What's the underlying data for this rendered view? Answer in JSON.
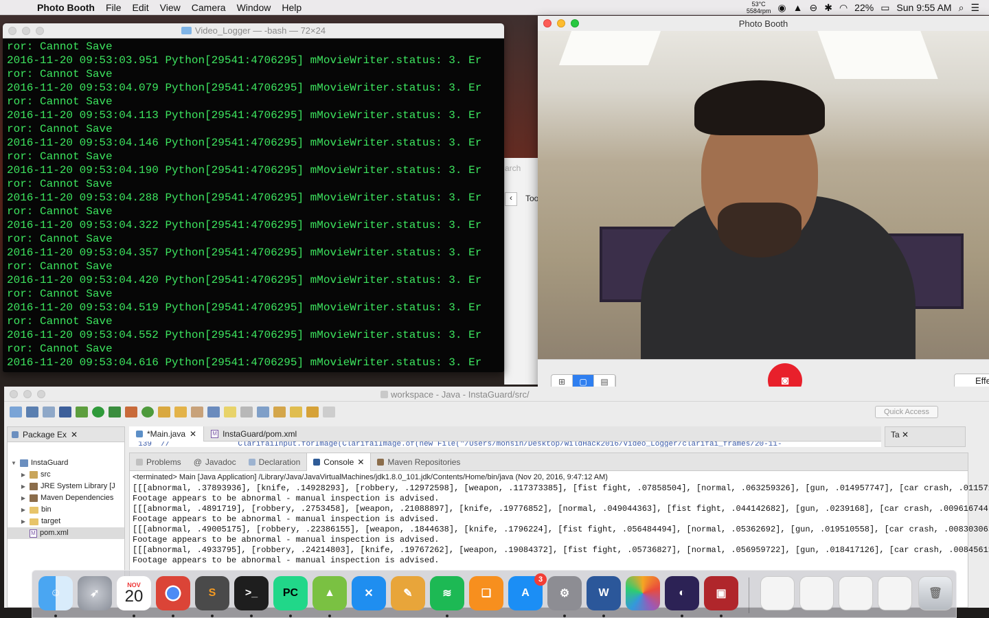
{
  "menubar": {
    "app_name": "Photo Booth",
    "menus": [
      "File",
      "Edit",
      "View",
      "Camera",
      "Window",
      "Help"
    ],
    "temp": "53°C",
    "rpm": "5584rpm",
    "battery": "22%",
    "clock": "Sun 9:55 AM"
  },
  "terminal": {
    "title": "Video_Logger — -bash — 72×24",
    "lines": [
      "ror: Cannot Save",
      "2016-11-20 09:53:03.951 Python[29541:4706295] mMovieWriter.status: 3. Er",
      "ror: Cannot Save",
      "2016-11-20 09:53:04.079 Python[29541:4706295] mMovieWriter.status: 3. Er",
      "ror: Cannot Save",
      "2016-11-20 09:53:04.113 Python[29541:4706295] mMovieWriter.status: 3. Er",
      "ror: Cannot Save",
      "2016-11-20 09:53:04.146 Python[29541:4706295] mMovieWriter.status: 3. Er",
      "ror: Cannot Save",
      "2016-11-20 09:53:04.190 Python[29541:4706295] mMovieWriter.status: 3. Er",
      "ror: Cannot Save",
      "2016-11-20 09:53:04.288 Python[29541:4706295] mMovieWriter.status: 3. Er",
      "ror: Cannot Save",
      "2016-11-20 09:53:04.322 Python[29541:4706295] mMovieWriter.status: 3. Er",
      "ror: Cannot Save",
      "2016-11-20 09:53:04.357 Python[29541:4706295] mMovieWriter.status: 3. Er",
      "ror: Cannot Save",
      "2016-11-20 09:53:04.420 Python[29541:4706295] mMovieWriter.status: 3. Er",
      "ror: Cannot Save",
      "2016-11-20 09:53:04.519 Python[29541:4706295] mMovieWriter.status: 3. Er",
      "ror: Cannot Save",
      "2016-11-20 09:53:04.552 Python[29541:4706295] mMovieWriter.status: 3. Er",
      "ror: Cannot Save",
      "2016-11-20 09:53:04.616 Python[29541:4706295] mMovieWriter.status: 3. Er"
    ]
  },
  "bg_window": {
    "search": "arch",
    "tool": "Too"
  },
  "photobooth": {
    "title": "Photo Booth",
    "effects_label": "Effe"
  },
  "eclipse": {
    "title": "workspace - Java - InstaGuard/src/",
    "quick_access": "Quick Access",
    "package_explorer": {
      "tab": "Package Ex",
      "items": [
        {
          "label": "InstaGuard",
          "icon": "project-icon"
        },
        {
          "label": "src",
          "icon": "package-icon"
        },
        {
          "label": "JRE System Library [J",
          "icon": "library-icon"
        },
        {
          "label": "Maven Dependencies",
          "icon": "library-icon"
        },
        {
          "label": "bin",
          "icon": "folder-icon"
        },
        {
          "label": "target",
          "icon": "folder-icon"
        },
        {
          "label": "pom.xml",
          "icon": "xml-file-icon"
        }
      ]
    },
    "editor_tabs": [
      "*Main.java",
      "InstaGuard/pom.xml"
    ],
    "editor_snippet": "  139  //               ClarifaiInput.forImage(ClarifaiImage.of(new File(\"/Users/mohsin/Desktop/WildHack2016/Video_Logger/clarifai_frames/20-11-",
    "outline_tab": "Ta",
    "console": {
      "tabs": [
        "Problems",
        "Javadoc",
        "Declaration",
        "Console",
        "Maven Repositories"
      ],
      "terminated": "<terminated> Main [Java Application] /Library/Java/JavaVirtualMachines/jdk1.8.0_101.jdk/Contents/Home/bin/java (Nov 20, 2016, 9:47:12 AM)",
      "lines": [
        "[[[abnormal, .37893936], [knife, .14928293], [robbery, .12972598], [weapon, .117373385], [fist fight, .07858504], [normal, .063259326], [gun, .014957747], [car crash, .011571",
        "Footage appears to be abnormal - manual inspection is advised.",
        "[[[abnormal, .4891719], [robbery, .2753458], [weapon, .21088897], [knife, .19776852], [normal, .049044363], [fist fight, .044142682], [gun, .0239168], [car crash, .009616744]",
        "Footage appears to be abnormal - manual inspection is advised.",
        "[[[abnormal, .49005175], [robbery, .22386155], [weapon, .1844638], [knife, .1796224], [fist fight, .056484494], [normal, .05362692], [gun, .019510558], [car crash, .008303063",
        "Footage appears to be abnormal - manual inspection is advised.",
        "[[[abnormal, .4933795], [robbery, .24214803], [knife, .19767262], [weapon, .19084372], [fist fight, .05736827], [normal, .056959722], [gun, .018417126], [car crash, .00845611",
        "Footage appears to be abnormal - manual inspection is advised."
      ]
    }
  },
  "dock": {
    "calendar_month": "NOV",
    "calendar_day": "20",
    "app_store_badge": "3",
    "apps": [
      "Finder",
      "Launchpad",
      "Calendar",
      "Chrome",
      "Sublime Text",
      "Terminal",
      "PyCharm",
      "Android Studio",
      "Xcode",
      "Brush",
      "Spotify",
      "iBooks",
      "App Store",
      "System Preferences",
      "Word",
      "Photos",
      "Eclipse",
      "Photo Booth"
    ]
  }
}
